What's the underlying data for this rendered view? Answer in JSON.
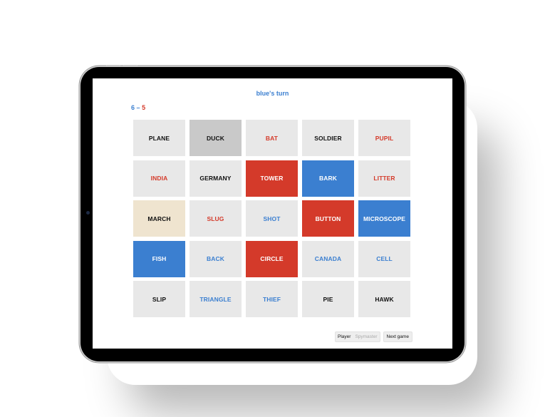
{
  "header": {
    "turn_text": "blue's turn"
  },
  "score": {
    "blue": "6",
    "separator": "–",
    "red": "5"
  },
  "colors": {
    "red": "#d43a2a",
    "blue": "#3b7fd0",
    "neutral_revealed": "#efe4cf",
    "assassin_revealed": "#c9c9c9",
    "unrevealed": "#e8e8e8"
  },
  "board": [
    {
      "word": "PLANE",
      "team": "neutral",
      "revealed": false
    },
    {
      "word": "DUCK",
      "team": "assassin",
      "revealed": true
    },
    {
      "word": "BAT",
      "team": "red",
      "revealed": false
    },
    {
      "word": "SOLDIER",
      "team": "neutral",
      "revealed": false
    },
    {
      "word": "PUPIL",
      "team": "red",
      "revealed": false
    },
    {
      "word": "INDIA",
      "team": "red",
      "revealed": false
    },
    {
      "word": "GERMANY",
      "team": "neutral",
      "revealed": false
    },
    {
      "word": "TOWER",
      "team": "red",
      "revealed": true
    },
    {
      "word": "BARK",
      "team": "blue",
      "revealed": true
    },
    {
      "word": "LITTER",
      "team": "red",
      "revealed": false
    },
    {
      "word": "MARCH",
      "team": "neutral",
      "revealed": true
    },
    {
      "word": "SLUG",
      "team": "red",
      "revealed": false
    },
    {
      "word": "SHOT",
      "team": "blue",
      "revealed": false
    },
    {
      "word": "BUTTON",
      "team": "red",
      "revealed": true
    },
    {
      "word": "MICROSCOPE",
      "team": "blue",
      "revealed": true
    },
    {
      "word": "FISH",
      "team": "blue",
      "revealed": true
    },
    {
      "word": "BACK",
      "team": "blue",
      "revealed": false
    },
    {
      "word": "CIRCLE",
      "team": "red",
      "revealed": true
    },
    {
      "word": "CANADA",
      "team": "blue",
      "revealed": false
    },
    {
      "word": "CELL",
      "team": "blue",
      "revealed": false
    },
    {
      "word": "SLIP",
      "team": "neutral",
      "revealed": false
    },
    {
      "word": "TRIANGLE",
      "team": "blue",
      "revealed": false
    },
    {
      "word": "THIEF",
      "team": "blue",
      "revealed": false
    },
    {
      "word": "PIE",
      "team": "neutral",
      "revealed": false
    },
    {
      "word": "HAWK",
      "team": "neutral",
      "revealed": false
    }
  ],
  "controls": {
    "role_options": [
      "Player",
      "Spymaster"
    ],
    "role_selected": "Player",
    "next_game_label": "Next game"
  }
}
